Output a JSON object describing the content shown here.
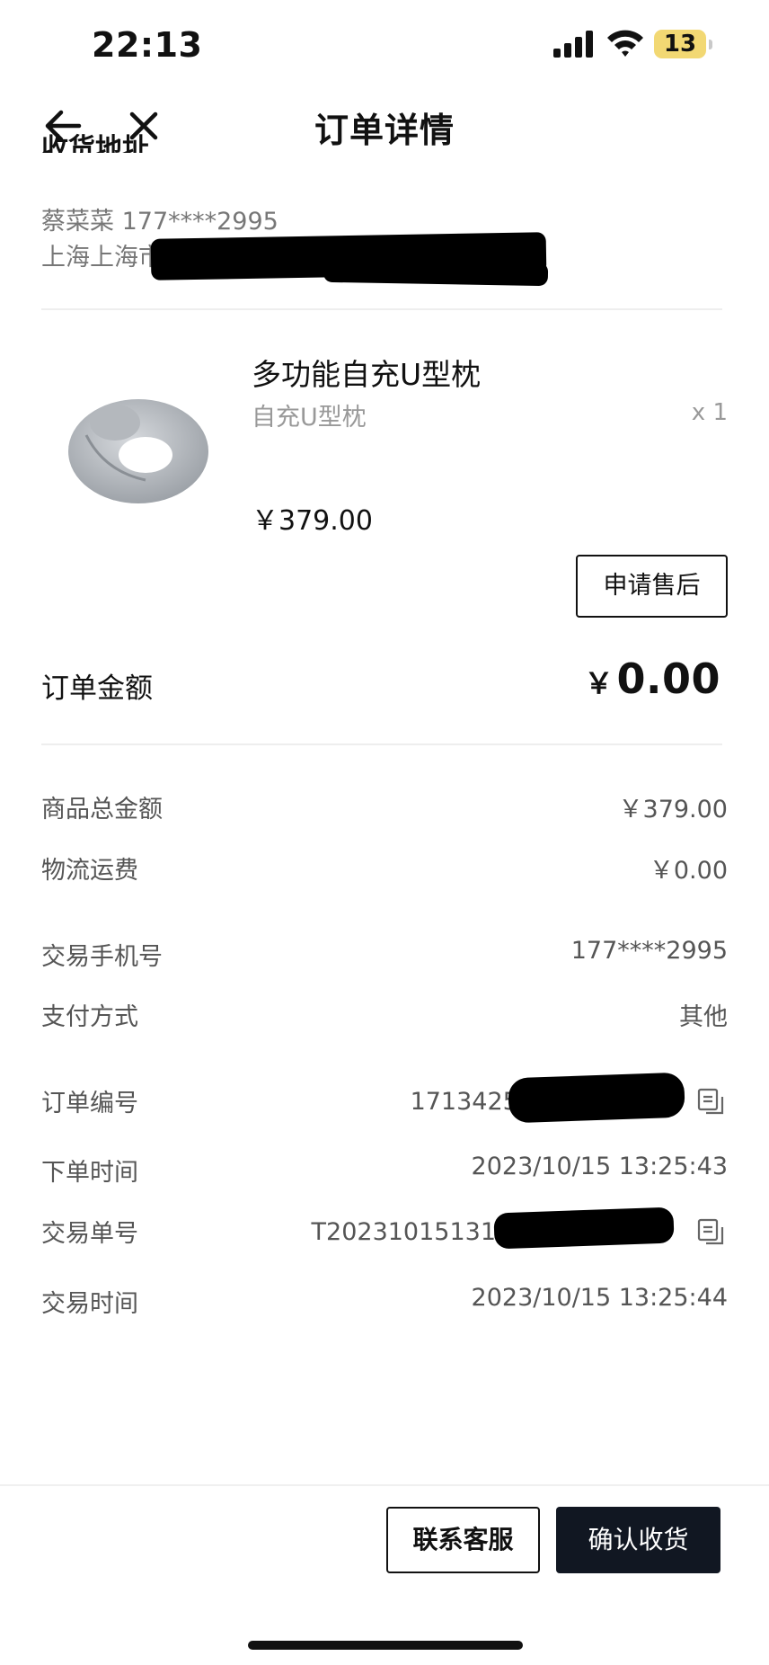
{
  "status_bar": {
    "time": "22:13",
    "battery": "13",
    "signal_icon": "cellular-signal-icon",
    "wifi_icon": "wifi-icon"
  },
  "nav": {
    "title": "订单详情",
    "back_icon": "arrow-left-icon",
    "close_icon": "close-icon"
  },
  "address": {
    "heading": "收货地址",
    "name_phone": "蔡菜菜  177****2995",
    "line_prefix": "上海上海市"
  },
  "product": {
    "name": "多功能自充U型枕",
    "spec": "自充U型枕",
    "qty": "x 1",
    "price": "￥379.00",
    "image_icon": "u-shaped-pillow-image",
    "after_sale_label": "申请售后"
  },
  "order_amount": {
    "label": "订单金额",
    "currency": "￥",
    "value": "0.00"
  },
  "details": {
    "goods_total_label": "商品总金额",
    "goods_total_value": "￥379.00",
    "shipping_label": "物流运费",
    "shipping_value": "￥0.00",
    "phone_label": "交易手机号",
    "phone_value": "177****2995",
    "payment_label": "支付方式",
    "payment_value": "其他",
    "order_no_label": "订单编号",
    "order_no_value": "17134259",
    "order_time_label": "下单时间",
    "order_time_value": "2023/10/15 13:25:43",
    "trade_no_label": "交易单号",
    "trade_no_value": "T20231015131",
    "trade_time_label": "交易时间",
    "trade_time_value": "2023/10/15 13:25:44"
  },
  "bottom_bar": {
    "contact_label": "联系客服",
    "confirm_label": "确认收货"
  },
  "colors": {
    "primary_button": "#111722",
    "muted_text": "#999999",
    "divider": "#eeeeee",
    "battery": "#f2d873"
  }
}
